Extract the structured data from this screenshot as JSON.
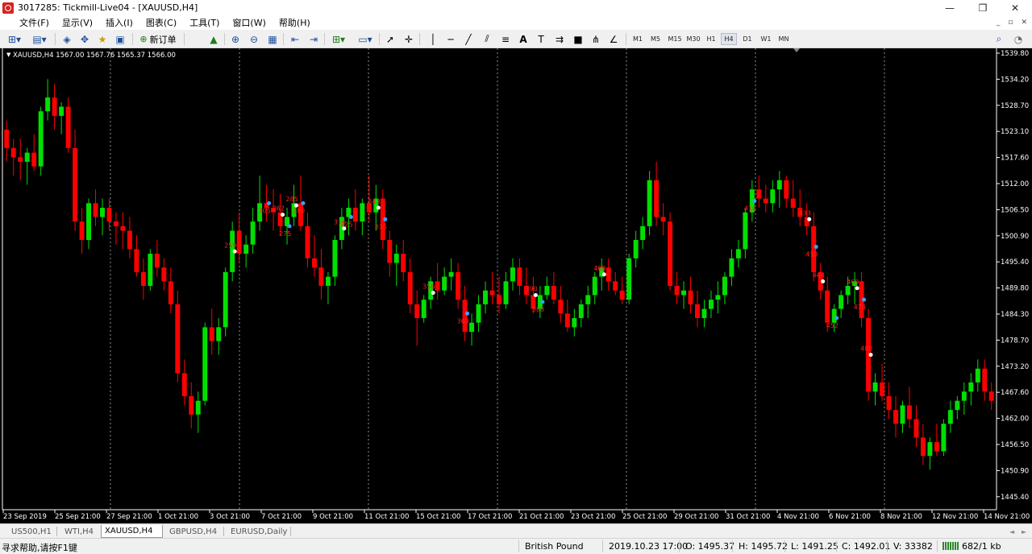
{
  "window": {
    "title": "3017285: Tickmill-Live04 - [XAUUSD,H4]",
    "controls": {
      "minimize": "—",
      "restore": "❐",
      "close": "✕"
    }
  },
  "menu": [
    "文件(F)",
    "显示(V)",
    "插入(I)",
    "图表(C)",
    "工具(T)",
    "窗口(W)",
    "帮助(H)"
  ],
  "toolbar": {
    "new_order": "新订单",
    "timeframes": [
      "M1",
      "M5",
      "M15",
      "M30",
      "H1",
      "H4",
      "D1",
      "W1",
      "MN"
    ],
    "active_timeframe": "H4",
    "icons": [
      "new-chart-icon",
      "profiles-icon",
      "market-watch-icon",
      "navigator-icon",
      "terminal-icon",
      "data-window-icon",
      "new-order-icon",
      "autotrading-icon",
      "zoom-in-icon",
      "zoom-out-icon",
      "tile-windows-icon",
      "chart-shift-icon",
      "auto-scroll-icon",
      "indicators-icon",
      "templates-icon",
      "cursor-icon",
      "crosshair-icon",
      "vertical-line-icon",
      "horizontal-line-icon",
      "trendline-icon",
      "equidistant-channel-icon",
      "fibonacci-icon",
      "text-icon",
      "text-label-icon",
      "arrows-icon",
      "rectangle-icon",
      "pitchfork-icon",
      "gann-icon",
      "search-icon",
      "chat-icon"
    ]
  },
  "chart": {
    "symbol_header": "XAUUSD,H4  1567.00 1567.76 1565.37 1566.00",
    "background": "#000000",
    "bull_color": "#00e000",
    "bear_color": "#ff0000",
    "grid_color": "#c0c0c0",
    "price_axis_labels": [
      "1539.80",
      "1534.20",
      "1528.70",
      "1523.10",
      "1517.60",
      "1512.00",
      "1506.50",
      "1500.90",
      "1495.40",
      "1489.80",
      "1484.30",
      "1478.70",
      "1473.20",
      "1467.60",
      "1462.00",
      "1456.50",
      "1450.90",
      "1445.40"
    ],
    "time_axis_labels": [
      "23 Sep 2019",
      "25 Sep 21:00",
      "27 Sep 21:00",
      "1 Oct 21:00",
      "3 Oct 21:00",
      "7 Oct 21:00",
      "9 Oct 21:00",
      "11 Oct 21:00",
      "15 Oct 21:00",
      "17 Oct 21:00",
      "21 Oct 21:00",
      "23 Oct 21:00",
      "25 Oct 21:00",
      "29 Oct 21:00",
      "31 Oct 21:00",
      "4 Nov 21:00",
      "6 Nov 21:00",
      "8 Nov 21:00",
      "12 Nov 21:00",
      "14 Nov 21:00"
    ],
    "trade_labels": [
      "259",
      "305",
      "262",
      "275",
      "285",
      "289",
      "316",
      "325",
      "343",
      "335",
      "356",
      "369",
      "390",
      "388",
      "408",
      "416",
      "433",
      "439",
      "444",
      "452",
      "469",
      "478",
      "488"
    ]
  },
  "chart_data": {
    "type": "candlestick",
    "ylim": [
      1443.0,
      1542.0
    ],
    "ohlc": [
      [
        1525,
        1527,
        1518,
        1521
      ],
      [
        1521,
        1523,
        1515,
        1519
      ],
      [
        1519,
        1523,
        1514,
        1518
      ],
      [
        1518,
        1521,
        1513,
        1520
      ],
      [
        1520,
        1524,
        1516,
        1517
      ],
      [
        1517,
        1530,
        1515,
        1529
      ],
      [
        1529,
        1536,
        1527,
        1532
      ],
      [
        1532,
        1535,
        1525,
        1528
      ],
      [
        1528,
        1531,
        1524,
        1530
      ],
      [
        1530,
        1532,
        1520,
        1521
      ],
      [
        1521,
        1525,
        1503,
        1505
      ],
      [
        1505,
        1508,
        1498,
        1501
      ],
      [
        1501,
        1510,
        1499,
        1509
      ],
      [
        1509,
        1512,
        1504,
        1506
      ],
      [
        1506,
        1510,
        1502,
        1508
      ],
      [
        1508,
        1510,
        1503,
        1505
      ],
      [
        1505,
        1507,
        1500,
        1504
      ],
      [
        1504,
        1507,
        1499,
        1503
      ],
      [
        1503,
        1506,
        1497,
        1499
      ],
      [
        1499,
        1502,
        1493,
        1494
      ],
      [
        1494,
        1497,
        1488,
        1491
      ],
      [
        1491,
        1499,
        1490,
        1498
      ],
      [
        1498,
        1501,
        1493,
        1495
      ],
      [
        1495,
        1497,
        1490,
        1492
      ],
      [
        1492,
        1495,
        1485,
        1487
      ],
      [
        1487,
        1490,
        1470,
        1472
      ],
      [
        1472,
        1475,
        1465,
        1467
      ],
      [
        1467,
        1470,
        1460,
        1463
      ],
      [
        1463,
        1468,
        1459,
        1466
      ],
      [
        1466,
        1483,
        1465,
        1482
      ],
      [
        1482,
        1486,
        1476,
        1479
      ],
      [
        1479,
        1484,
        1476,
        1482
      ],
      [
        1482,
        1495,
        1480,
        1494
      ],
      [
        1494,
        1505,
        1492,
        1503
      ],
      [
        1503,
        1507,
        1496,
        1498
      ],
      [
        1498,
        1502,
        1495,
        1500
      ],
      [
        1500,
        1508,
        1498,
        1505
      ],
      [
        1505,
        1515,
        1503,
        1509
      ],
      [
        1509,
        1513,
        1505,
        1508
      ],
      [
        1508,
        1512,
        1503,
        1507
      ],
      [
        1507,
        1511,
        1502,
        1504
      ],
      [
        1504,
        1508,
        1500,
        1506
      ],
      [
        1506,
        1513,
        1504,
        1509
      ],
      [
        1509,
        1515,
        1503,
        1504
      ],
      [
        1504,
        1507,
        1495,
        1497
      ],
      [
        1497,
        1502,
        1493,
        1495
      ],
      [
        1495,
        1499,
        1488,
        1491
      ],
      [
        1491,
        1494,
        1487,
        1493
      ],
      [
        1493,
        1502,
        1491,
        1501
      ],
      [
        1501,
        1508,
        1499,
        1506
      ],
      [
        1506,
        1510,
        1502,
        1508
      ],
      [
        1508,
        1512,
        1503,
        1505
      ],
      [
        1505,
        1510,
        1502,
        1509
      ],
      [
        1509,
        1515,
        1505,
        1507
      ],
      [
        1507,
        1513,
        1503,
        1510
      ],
      [
        1510,
        1512,
        1499,
        1501
      ],
      [
        1501,
        1503,
        1493,
        1496
      ],
      [
        1496,
        1500,
        1491,
        1498
      ],
      [
        1498,
        1501,
        1492,
        1494
      ],
      [
        1494,
        1497,
        1485,
        1487
      ],
      [
        1487,
        1490,
        1478,
        1484
      ],
      [
        1484,
        1489,
        1483,
        1488
      ],
      [
        1488,
        1493,
        1486,
        1492
      ],
      [
        1492,
        1496,
        1488,
        1490
      ],
      [
        1490,
        1495,
        1489,
        1493
      ],
      [
        1493,
        1497,
        1490,
        1494
      ],
      [
        1494,
        1496,
        1486,
        1488
      ],
      [
        1488,
        1491,
        1479,
        1481
      ],
      [
        1481,
        1485,
        1478,
        1483
      ],
      [
        1483,
        1489,
        1481,
        1487
      ],
      [
        1487,
        1492,
        1485,
        1490
      ],
      [
        1490,
        1494,
        1487,
        1489
      ],
      [
        1489,
        1493,
        1485,
        1487
      ],
      [
        1487,
        1494,
        1486,
        1492
      ],
      [
        1492,
        1497,
        1490,
        1495
      ],
      [
        1495,
        1497,
        1489,
        1491
      ],
      [
        1491,
        1495,
        1487,
        1489
      ],
      [
        1489,
        1493,
        1485,
        1486
      ],
      [
        1486,
        1491,
        1484,
        1489
      ],
      [
        1489,
        1493,
        1488,
        1491
      ],
      [
        1491,
        1494,
        1487,
        1488
      ],
      [
        1488,
        1491,
        1483,
        1485
      ],
      [
        1485,
        1488,
        1481,
        1482
      ],
      [
        1482,
        1486,
        1480,
        1484
      ],
      [
        1484,
        1488,
        1482,
        1487
      ],
      [
        1487,
        1491,
        1484,
        1489
      ],
      [
        1489,
        1494,
        1487,
        1493
      ],
      [
        1493,
        1497,
        1490,
        1495
      ],
      [
        1495,
        1497,
        1490,
        1492
      ],
      [
        1492,
        1494,
        1489,
        1490
      ],
      [
        1490,
        1493,
        1487,
        1488
      ],
      [
        1488,
        1498,
        1487,
        1497
      ],
      [
        1497,
        1503,
        1495,
        1501
      ],
      [
        1501,
        1506,
        1499,
        1504
      ],
      [
        1504,
        1516,
        1502,
        1514
      ],
      [
        1514,
        1518,
        1504,
        1506
      ],
      [
        1506,
        1509,
        1502,
        1505
      ],
      [
        1505,
        1507,
        1490,
        1491
      ],
      [
        1491,
        1494,
        1487,
        1489
      ],
      [
        1489,
        1492,
        1486,
        1490
      ],
      [
        1490,
        1493,
        1485,
        1487
      ],
      [
        1487,
        1490,
        1482,
        1484
      ],
      [
        1484,
        1488,
        1482,
        1486
      ],
      [
        1486,
        1490,
        1484,
        1488
      ],
      [
        1488,
        1492,
        1485,
        1489
      ],
      [
        1489,
        1494,
        1487,
        1493
      ],
      [
        1493,
        1499,
        1491,
        1497
      ],
      [
        1497,
        1501,
        1495,
        1499
      ],
      [
        1499,
        1508,
        1497,
        1507
      ],
      [
        1507,
        1514,
        1505,
        1512
      ],
      [
        1512,
        1515,
        1508,
        1510
      ],
      [
        1510,
        1513,
        1507,
        1509
      ],
      [
        1509,
        1514,
        1507,
        1512
      ],
      [
        1512,
        1516,
        1508,
        1514
      ],
      [
        1514,
        1515,
        1508,
        1510
      ],
      [
        1510,
        1514,
        1506,
        1508
      ],
      [
        1508,
        1512,
        1504,
        1506
      ],
      [
        1506,
        1509,
        1502,
        1504
      ],
      [
        1504,
        1507,
        1492,
        1494
      ],
      [
        1494,
        1496,
        1488,
        1490
      ],
      [
        1490,
        1493,
        1481,
        1483
      ],
      [
        1483,
        1487,
        1481,
        1486
      ],
      [
        1486,
        1490,
        1484,
        1489
      ],
      [
        1489,
        1493,
        1487,
        1491
      ],
      [
        1491,
        1494,
        1487,
        1492
      ],
      [
        1492,
        1494,
        1482,
        1484
      ],
      [
        1484,
        1486,
        1466,
        1468
      ],
      [
        1468,
        1472,
        1465,
        1470
      ],
      [
        1470,
        1474,
        1466,
        1467
      ],
      [
        1467,
        1470,
        1462,
        1464
      ],
      [
        1464,
        1467,
        1458,
        1461
      ],
      [
        1461,
        1466,
        1459,
        1465
      ],
      [
        1465,
        1469,
        1460,
        1462
      ],
      [
        1462,
        1465,
        1456,
        1458
      ],
      [
        1458,
        1461,
        1452,
        1454
      ],
      [
        1454,
        1458,
        1451,
        1457
      ],
      [
        1457,
        1461,
        1454,
        1455
      ],
      [
        1455,
        1462,
        1454,
        1461
      ],
      [
        1461,
        1466,
        1459,
        1464
      ],
      [
        1464,
        1467,
        1462,
        1466
      ],
      [
        1466,
        1470,
        1463,
        1468
      ],
      [
        1468,
        1472,
        1465,
        1470
      ],
      [
        1470,
        1475,
        1468,
        1473
      ],
      [
        1473,
        1475,
        1466,
        1468
      ],
      [
        1468,
        1470,
        1464,
        1466
      ]
    ]
  },
  "symbol_tabs": [
    "US500,H1",
    "WTI,H4",
    "XAUUSD,H4",
    "GBPUSD,H4",
    "EURUSD,Daily"
  ],
  "active_tab": "XAUUSD,H4",
  "status": {
    "help": "寻求帮助,请按F1键",
    "profile": "British Pound",
    "datetime": "2019.10.23 17:00",
    "open": "O: 1495.37",
    "high": "H: 1495.72",
    "low": "L: 1491.25",
    "close": "C: 1492.01",
    "volume": "V: 33382",
    "traffic": "682/1 kb"
  }
}
